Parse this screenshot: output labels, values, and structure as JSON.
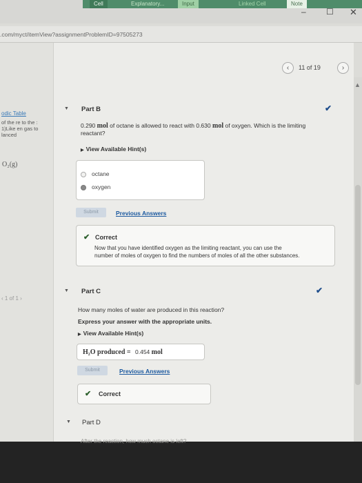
{
  "tabs": {
    "cell": "Cell",
    "explanatory": "Explanatory...",
    "input": "Input",
    "linked_cell": "Linked Cell",
    "note": "Note"
  },
  "window": {
    "minimize": "–",
    "maximize": "☐",
    "close": "✕"
  },
  "url": ".com/myct/itemView?assignmentProblemID=97505273",
  "pager": {
    "prev": "‹",
    "count": "11 of 19",
    "next": "›"
  },
  "sidebar": {
    "link": "odic Table",
    "text": "of the re to the : 1)Like en gas to lanced",
    "chem": "O₂(g)",
    "pager": "‹  1 of 1  ›"
  },
  "partB": {
    "title": "Part B",
    "prompt_a": "0.290",
    "prompt_unit1": "mol",
    "prompt_b": "of octane is allowed to react with 0.630",
    "prompt_unit2": "mol",
    "prompt_c": "of oxygen. Which is the limiting",
    "prompt_d": "reactant?",
    "hint": "View Available Hint(s)",
    "options": [
      "octane",
      "oxygen"
    ],
    "selected": 1,
    "submit": "Submit",
    "previous_answers": "Previous Answers",
    "feedback_title": "Correct",
    "feedback_line1": "Now that you have identified oxygen as the limiting reactant, you can use the",
    "feedback_line2": "number of moles of oxygen to find the numbers of moles of all the other substances."
  },
  "partC": {
    "title": "Part C",
    "prompt": "How many moles of water are produced in this reaction?",
    "instruction": "Express your answer with the appropriate units.",
    "hint": "View Available Hint(s)",
    "answer_label": "H₂O produced =",
    "answer_value": "0.454",
    "answer_unit": "mol",
    "submit": "Submit",
    "previous_answers": "Previous Answers",
    "feedback_title": "Correct"
  },
  "partD": {
    "title": "Part D",
    "prompt": "After the reaction, how much octane is left?"
  },
  "colors": {
    "accent": "#1e4d8c",
    "link": "#1d5aa0",
    "tab_green": "#4f8c6a"
  }
}
